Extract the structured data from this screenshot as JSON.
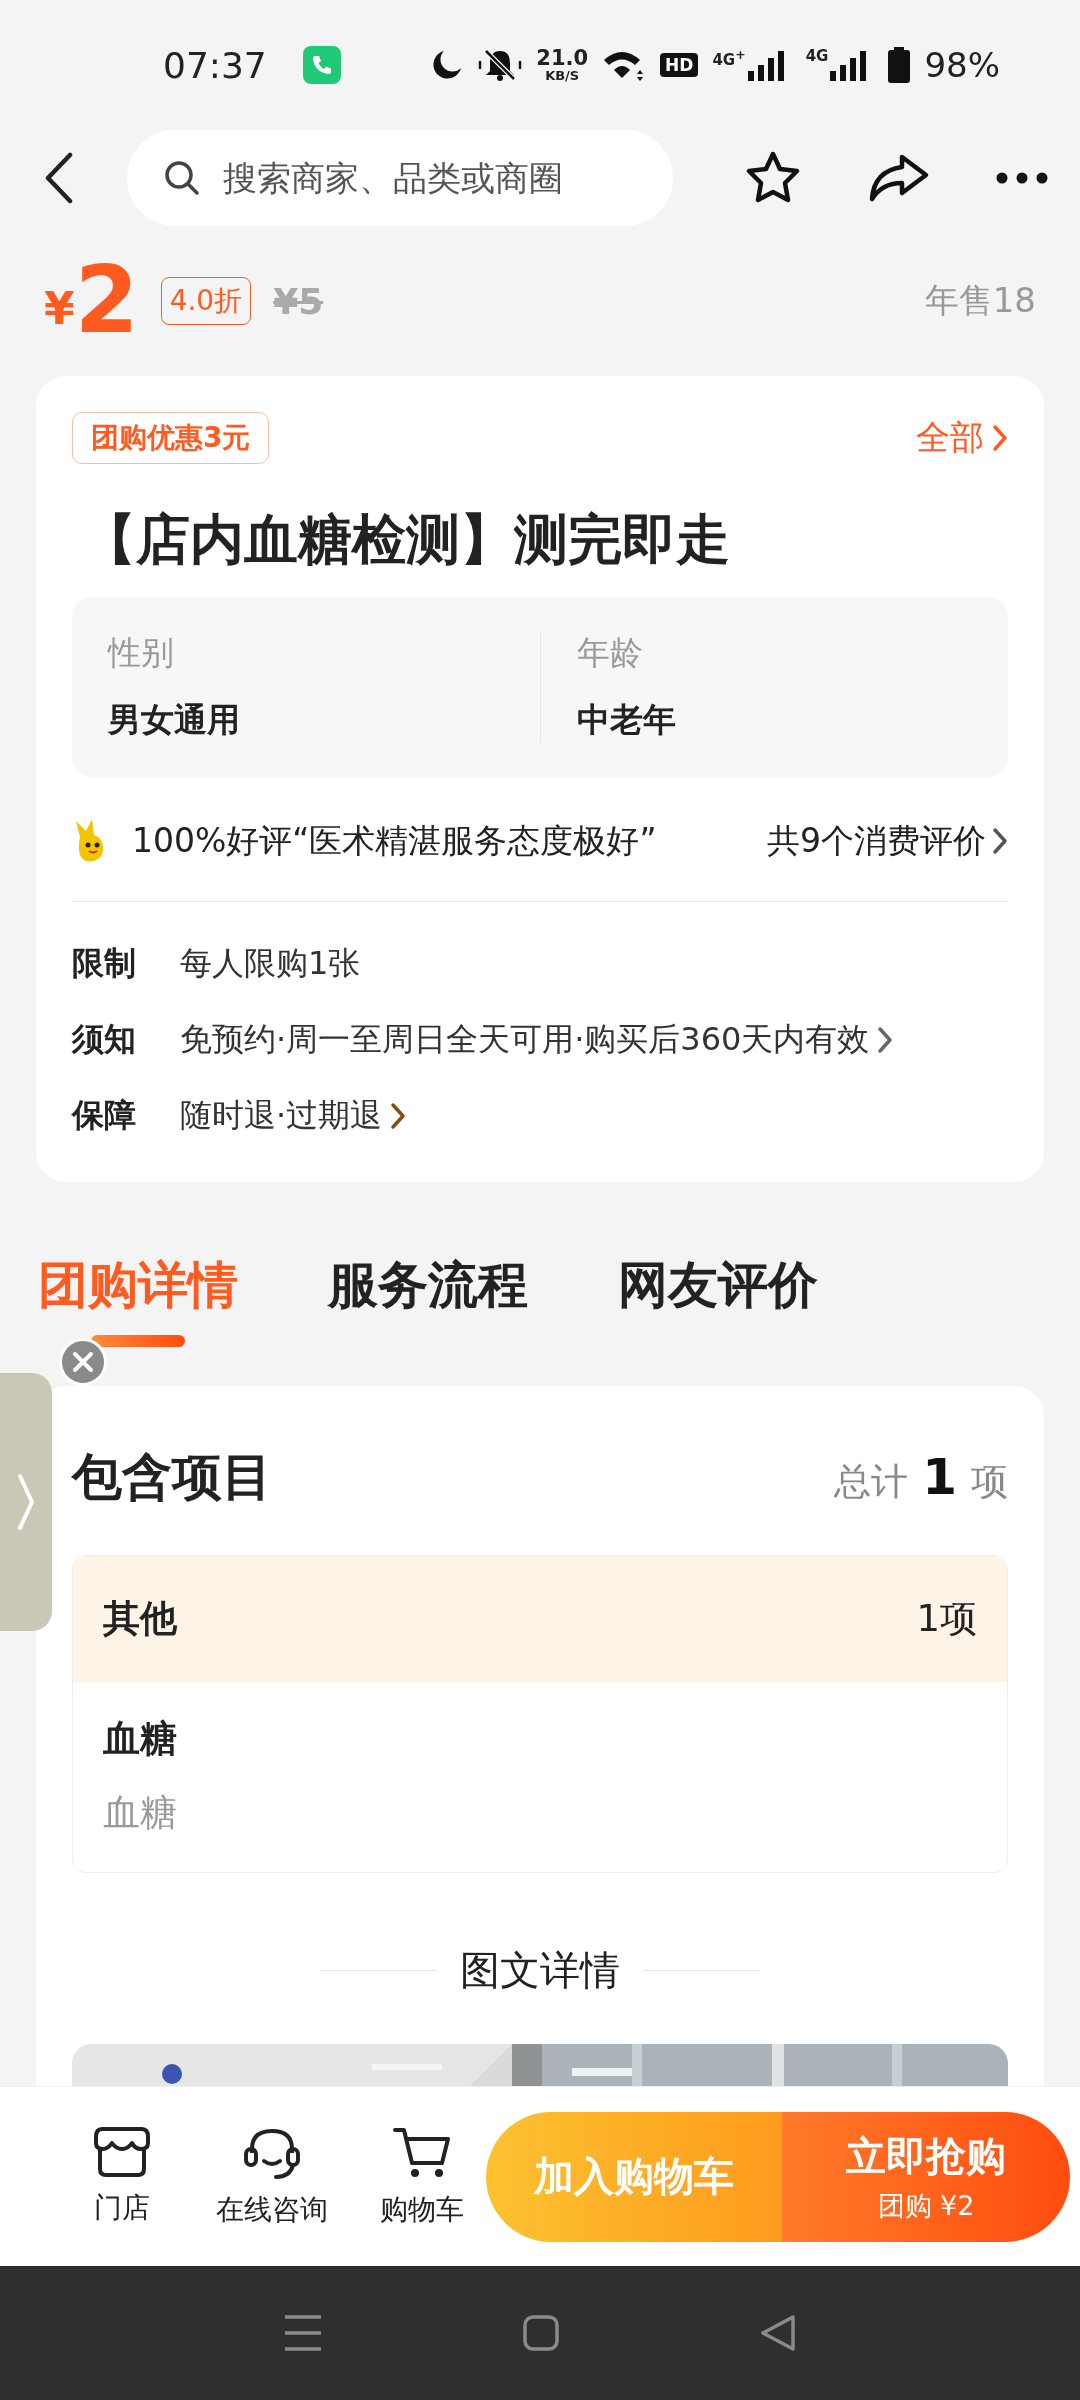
{
  "status_bar": {
    "time": "07:37",
    "net_speed": "21.0",
    "net_unit": "KB/S",
    "hd": "HD",
    "signal_1": "4G$^{+}$",
    "signal_2": "4G",
    "battery": "98%"
  },
  "search": {
    "placeholder": "搜索商家、品类或商圈"
  },
  "price": {
    "currency": "¥",
    "amount": "2",
    "discount": "4.0折",
    "original": "¥5",
    "sales": "年售18"
  },
  "deal": {
    "coupon": "团购优惠3元",
    "all_link": "全部",
    "title": "【店内血糖检测】测完即走",
    "attributes": [
      {
        "label": "性别",
        "value": "男女通用"
      },
      {
        "label": "年龄",
        "value": "中老年"
      }
    ],
    "review": {
      "summary": "100%好评“医术精湛服务态度极好”",
      "count": "共9个消费评价"
    },
    "rules": [
      {
        "label": "限制",
        "value": "每人限购1张",
        "kind": "plain"
      },
      {
        "label": "须知",
        "value": "免预约·周一至周日全天可用·购买后360天内有效",
        "kind": "more"
      },
      {
        "label": "保障",
        "value": "随时退·过期退",
        "kind": "guarantee"
      }
    ]
  },
  "tabs": [
    {
      "label": "团购详情",
      "selected": true
    },
    {
      "label": "服务流程",
      "selected": false
    },
    {
      "label": "网友评价",
      "selected": false
    }
  ],
  "included": {
    "title": "包含项目",
    "total_prefix": "总计",
    "total_count": "1",
    "total_unit": "项",
    "groups": [
      {
        "name": "其他",
        "count": "1项",
        "items": [
          {
            "name": "血糖",
            "detail": "血糖"
          }
        ]
      }
    ]
  },
  "details_heading": "图文详情",
  "bottom_bar": {
    "actions": [
      {
        "label": "门店",
        "kind": "store"
      },
      {
        "label": "在线咨询",
        "kind": "support"
      },
      {
        "label": "购物车",
        "kind": "cart"
      }
    ],
    "add_to_cart": "加入购物车",
    "buy_now": {
      "label": "立即抢购",
      "sub": "团购 ¥2"
    }
  }
}
